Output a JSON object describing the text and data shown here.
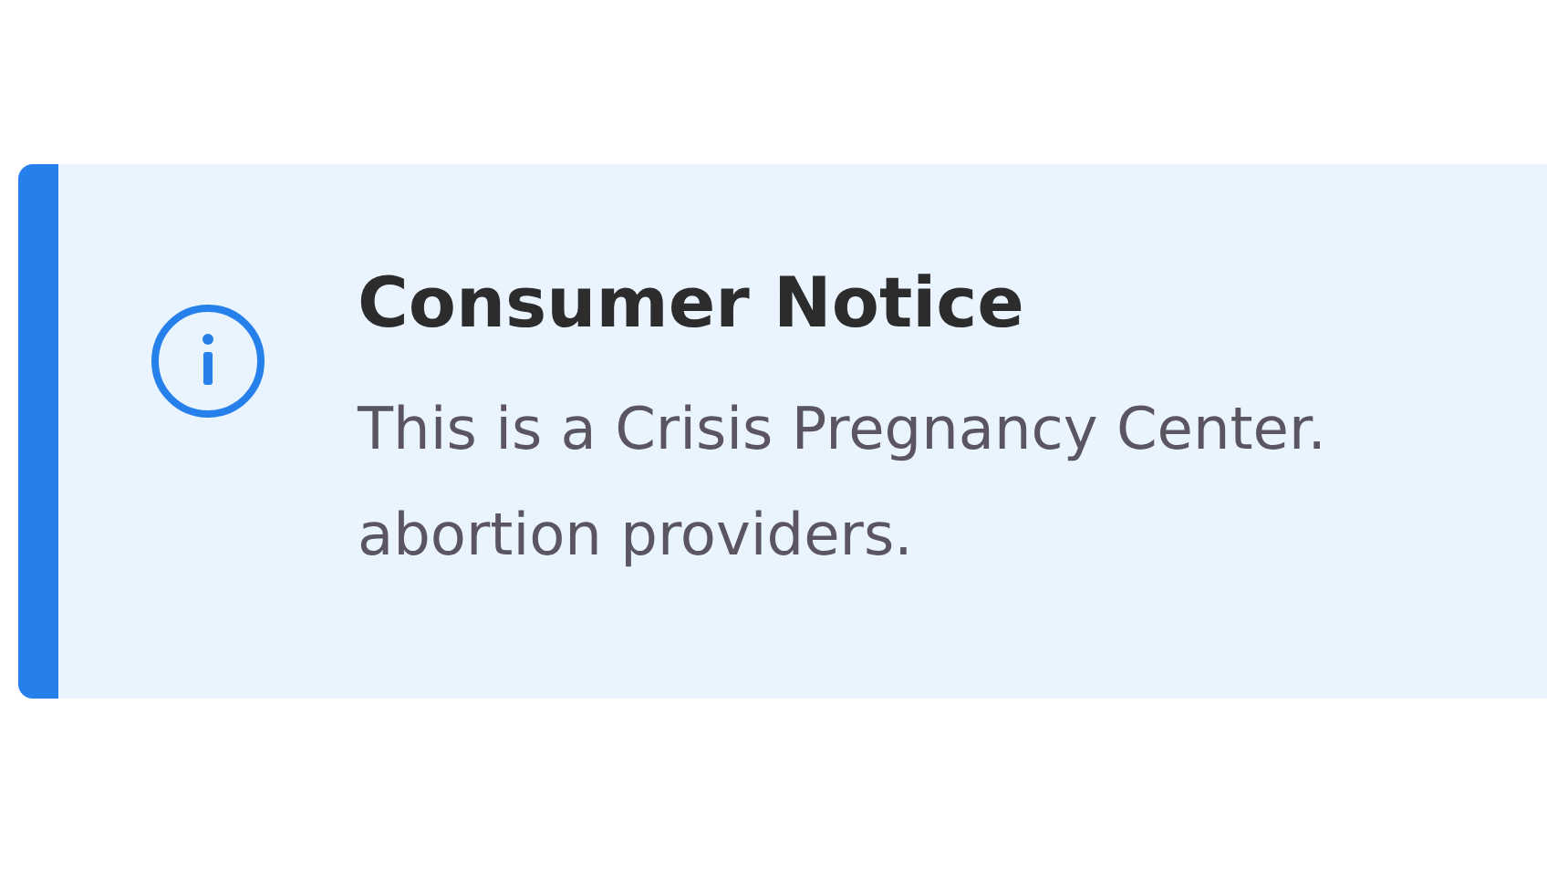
{
  "notice": {
    "title": "Consumer Notice",
    "body_lines": [
      "This is a Crisis Pregnancy Center.",
      "abortion providers."
    ]
  }
}
